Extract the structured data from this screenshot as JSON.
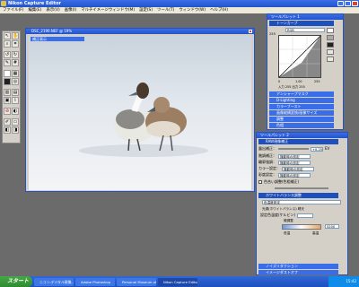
{
  "window": {
    "title": "Nikon Capture Editor"
  },
  "menu": [
    "ファイル(F)",
    "編集(E)",
    "表示(V)",
    "画像(I)",
    "マルチイメージウィンドウ(M)",
    "設定(S)",
    "ツール(T)",
    "ウィンドウ(W)",
    "ヘルプ(H)"
  ],
  "image_window": {
    "title": "DSC_2190.NEF @ 19%",
    "photo_label": "補正表示"
  },
  "palette1": {
    "title": "ツールパレット 1",
    "curve_section": "トーンカーブ",
    "channel": "RGB",
    "top_value": "255",
    "bottom_left": "0",
    "bottom_mid": "1.00",
    "bottom_right": "255",
    "io_label": "入力 255  出力 255",
    "sections": [
      "アンシャープマスク",
      "D-Lighting",
      "カラーブースト",
      "画像縦横変換/画像サイズ",
      "調整",
      "色相"
    ]
  },
  "palette2": {
    "title": "ツールパレット 2",
    "raw_section": "RAW現像補正",
    "rows": [
      {
        "label": "露出補正：",
        "value": "+0.25",
        "unit": "EV"
      },
      {
        "label": "階調補正：",
        "value": "撮影時の設定"
      },
      {
        "label": "輪郭強調：",
        "value": "撮影時の設定"
      },
      {
        "label": "カラー設定：",
        "value": "撮影時の設定"
      },
      {
        "label": "彩度設定：",
        "value": "撮影時の設定"
      }
    ],
    "check_row": "色合い調整(色相補正)",
    "wb_section": "ホワイトバランス調整",
    "wb_mode": "色温度設定",
    "wb_label1": "光源(ホワイトバランス)  晴天",
    "wb_label2": "設定色温度(ケルビン)",
    "wb_value": "5200",
    "wb_dial": "微調整",
    "wb_low": "低温",
    "wb_high": "高温",
    "bottom_sections": [
      "ノイズリダクション",
      "イメージダストオフ"
    ]
  },
  "taskbar": {
    "start": "スタート",
    "tasks": [
      "ニコン:デジタル現像...",
      "Adobe Photoshop",
      "Personal Museum of...",
      "Nikon Capture Editor"
    ],
    "clock": "15:42"
  },
  "colors": {
    "titlebar": "#2353c9",
    "accent": "#3a6ee8",
    "panel": "#d4d0c8"
  }
}
